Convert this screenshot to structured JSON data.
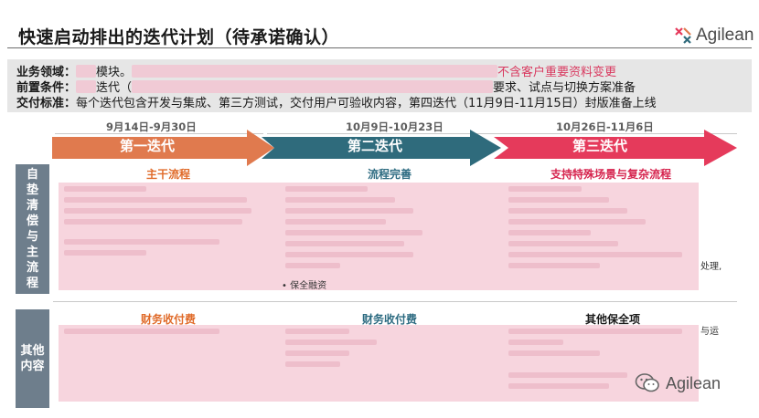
{
  "title": "快速启动排出的迭代计划（待承诺确认）",
  "logo": {
    "text": "Agilean"
  },
  "info": {
    "line1": {
      "label": "业务领域：",
      "visible_text": "模块。",
      "tail_red": "不含客户重要资料变更"
    },
    "line2": {
      "label": "前置条件：",
      "visible_text_a": "迭代（",
      "visible_text_b": "要求、试点与切换方案准备"
    },
    "line3": {
      "label": "交付标准：",
      "text": "每个迭代包含开发与集成、第三方测试，交付用户可验收内容，第四迭代（11月9日-11月15日）封版准备上线"
    }
  },
  "iterations": [
    {
      "date": "9月14日-9月30日",
      "name": "第一迭代",
      "color": "#e07a4e"
    },
    {
      "date": "10月9日-10月23日",
      "name": "第二迭代",
      "color": "#2f6b7c"
    },
    {
      "date": "10月26日-11月6日",
      "name": "第三迭代",
      "color": "#e53a5b"
    }
  ],
  "rows": [
    {
      "label": "自垫清偿与主流程"
    },
    {
      "label": "其他内容"
    }
  ],
  "columns_top": [
    {
      "heading": "主干流程"
    },
    {
      "heading": "流程完善",
      "last_bullet": "保全融资"
    },
    {
      "heading": "支持特殊场景与复杂流程",
      "trailing_text": "处理,"
    }
  ],
  "columns_bottom": [
    {
      "heading": "财务收付费"
    },
    {
      "heading": "财务收付费"
    },
    {
      "heading": "其他保全项",
      "trailing_text": "与运"
    }
  ],
  "watermark": {
    "text": "Agilean"
  },
  "colors": {
    "side_box": "#6e7e8c",
    "redaction": "#f6cfd9",
    "info_bg": "#e6e6e6"
  }
}
